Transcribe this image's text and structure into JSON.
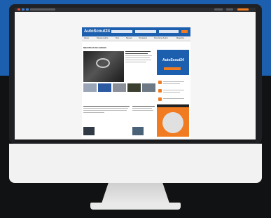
{
  "site": {
    "logo": "AutoScout24",
    "nav": [
      "Home",
      "Nieuwe Auto's",
      "Test",
      "Nieuws",
      "Occasions",
      "Duurzame Auto's",
      "Magazine"
    ],
    "section_title": "NIEUWS IN DE KIJKER"
  },
  "colors": {
    "brand_blue": "#1c5fae",
    "brand_orange": "#f07b21"
  }
}
